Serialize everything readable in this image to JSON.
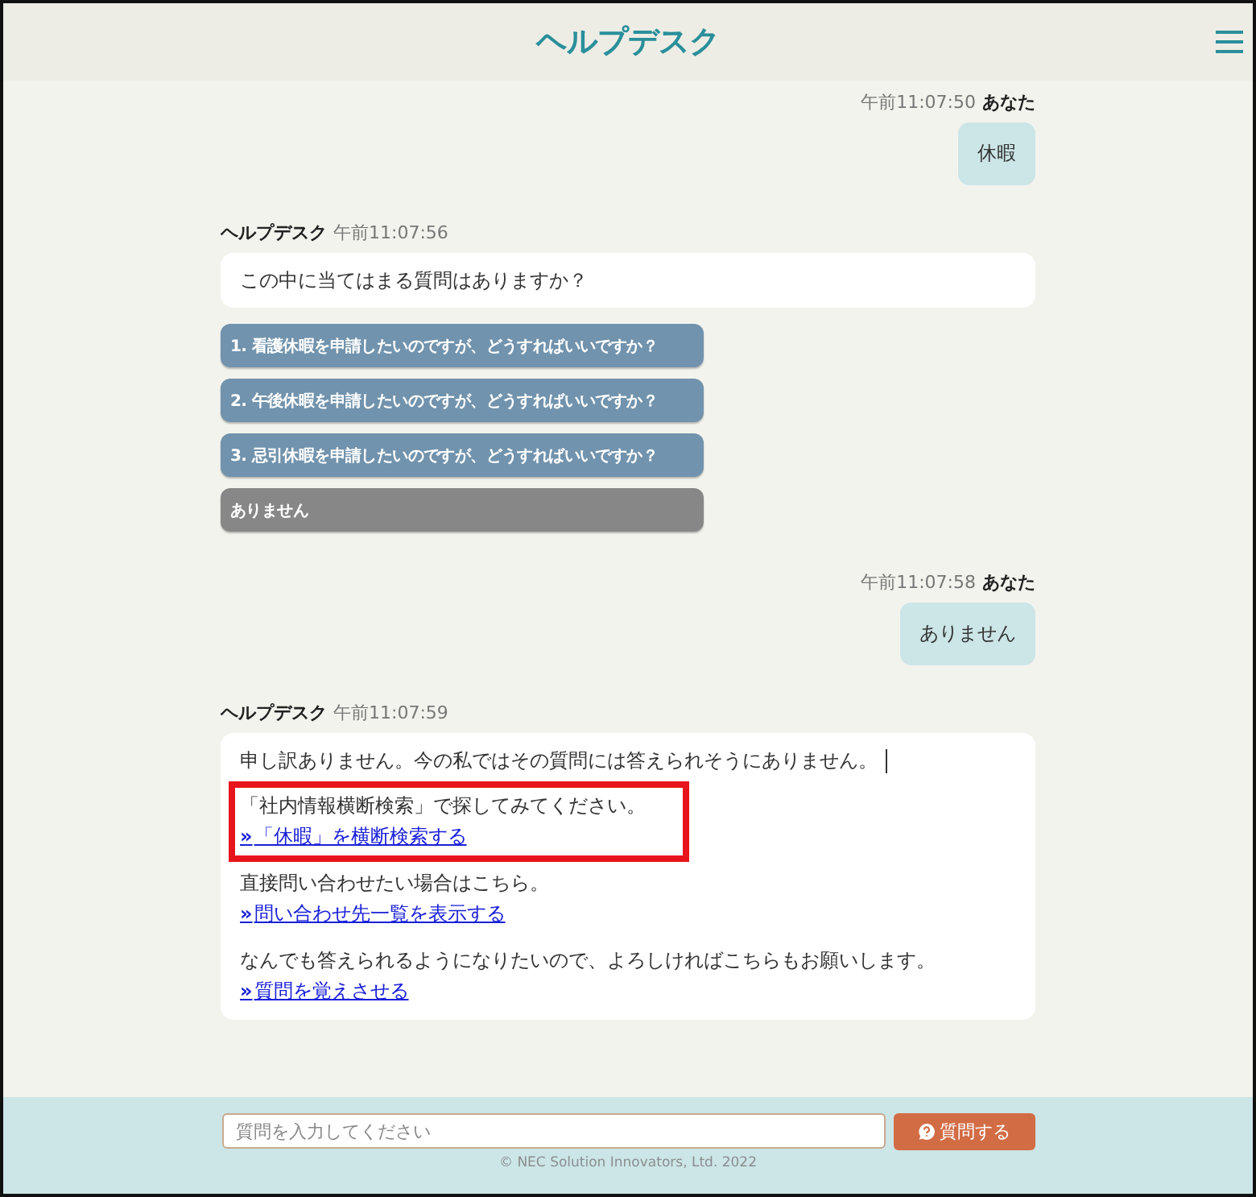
{
  "header": {
    "title": "ヘルプデスク"
  },
  "messages": [
    {
      "kind": "user",
      "time": "午前11:07:50",
      "sender": "あなた",
      "text": "休暇"
    },
    {
      "kind": "bot",
      "sender": "ヘルプデスク",
      "time": "午前11:07:56",
      "paragraphs": [
        {
          "text": "この中に当てはまる質問はありますか？",
          "caret": false,
          "highlighted": false
        }
      ],
      "choices": [
        {
          "kind": "question",
          "label": "1. 看護休暇を申請したいのですが、どうすればいいですか？"
        },
        {
          "kind": "question",
          "label": "2. 午後休暇を申請したいのですが、どうすればいいですか？"
        },
        {
          "kind": "question",
          "label": "3. 忌引休暇を申請したいのですが、どうすればいいですか？"
        },
        {
          "kind": "none",
          "label": "ありません"
        }
      ]
    },
    {
      "kind": "user",
      "time": "午前11:07:58",
      "sender": "あなた",
      "text": "ありません"
    },
    {
      "kind": "bot",
      "sender": "ヘルプデスク",
      "time": "午前11:07:59",
      "paragraphs": [
        {
          "text": "申し訳ありません。今の私ではその質問には答えられそうにありません。",
          "caret": true,
          "highlighted": false
        },
        {
          "text": "「社内情報横断検索」で探してみてください。",
          "link": {
            "marker": "»",
            "label": "「休暇」を横断検索する"
          },
          "caret": false,
          "highlighted": true
        },
        {
          "text": "直接問い合わせたい場合はこちら。",
          "link": {
            "marker": "»",
            "label": "問い合わせ先一覧を表示する"
          },
          "caret": false,
          "highlighted": false
        },
        {
          "text": "なんでも答えられるようになりたいので、よろしければこちらもお願いします。",
          "link": {
            "marker": "»",
            "label": "質問を覚えさせる"
          },
          "caret": false,
          "highlighted": false
        }
      ]
    }
  ],
  "footer": {
    "input": {
      "placeholder": "質問を入力してください"
    },
    "submit": {
      "label": "質問する"
    },
    "copyright": "© NEC Solution Innovators, Ltd. 2022"
  }
}
